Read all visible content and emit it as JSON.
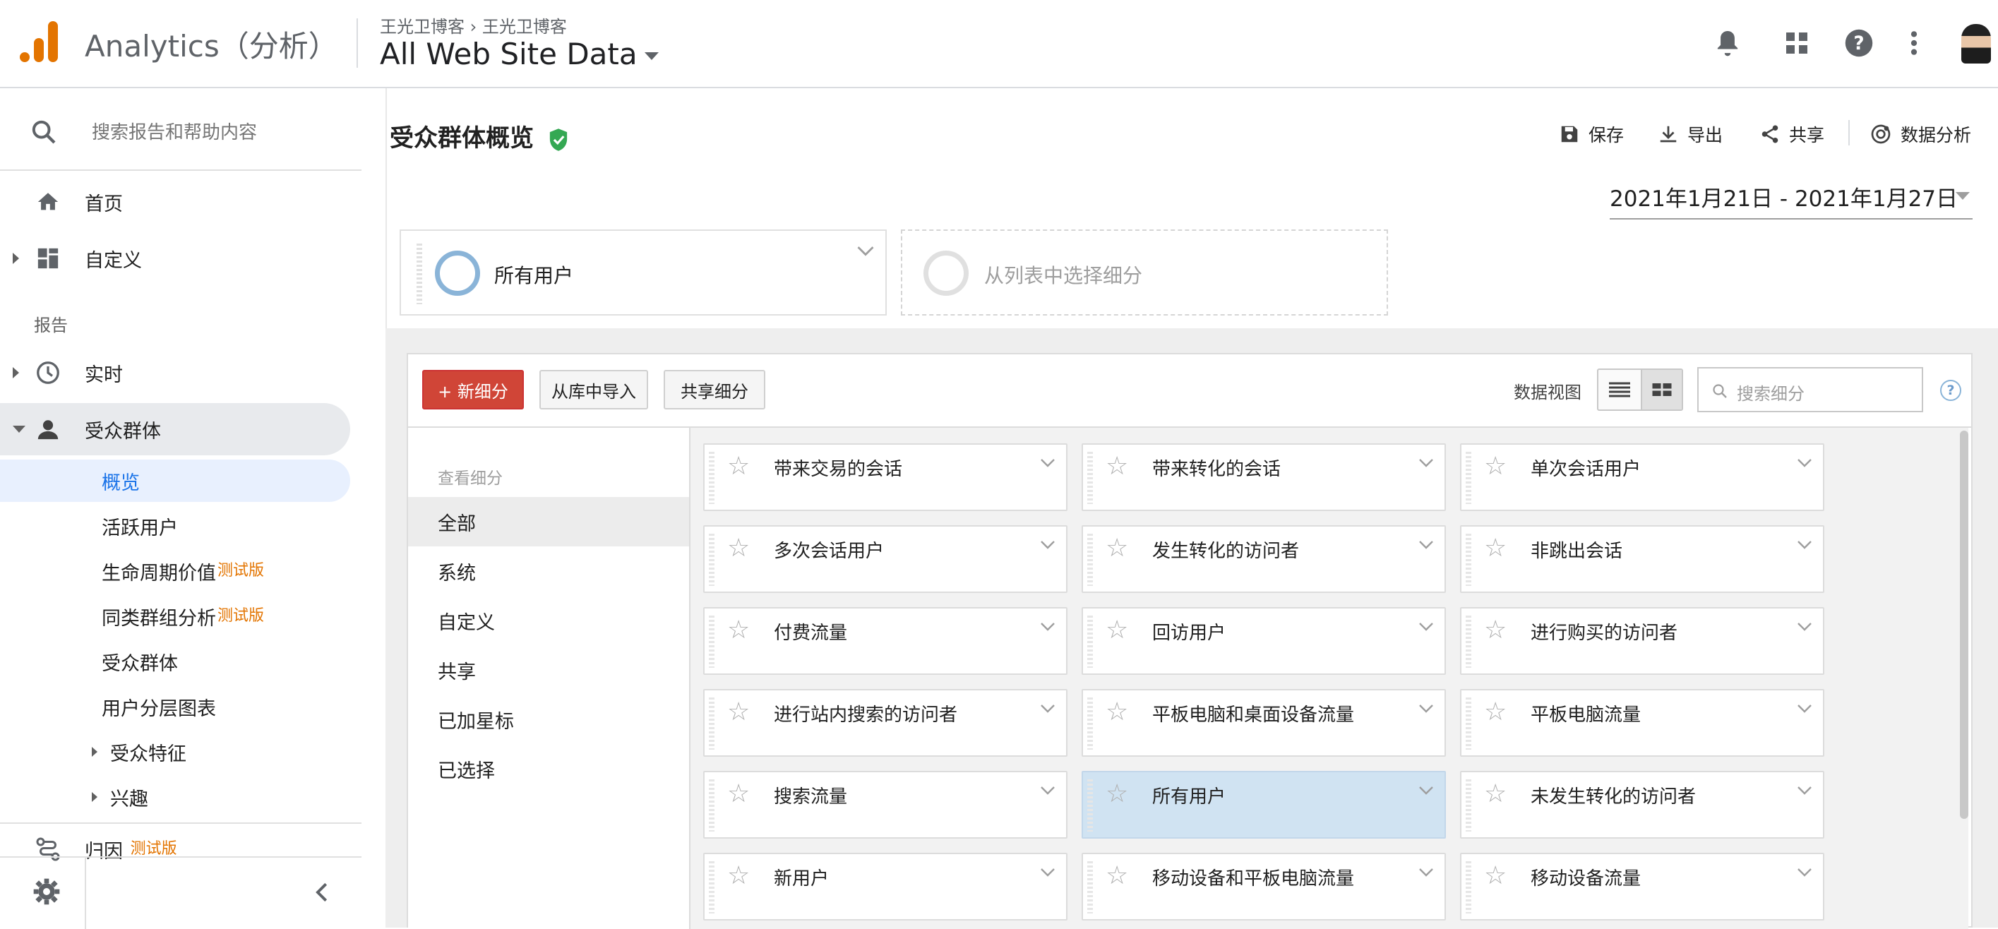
{
  "app": {
    "name": "Analytics（分析）",
    "breadcrumb_account": "王光卫博客",
    "breadcrumb_property": "王光卫博客",
    "view": "All Web Site Data"
  },
  "topbar_icons": [
    "bell-icon",
    "apps-icon",
    "help-icon",
    "more-vert-icon"
  ],
  "sidebar": {
    "search_placeholder": "搜索报告和帮助内容",
    "home": "首页",
    "customize": "自定义",
    "reports_section": "报告",
    "realtime": "实时",
    "audience": "受众群体",
    "audience_sub": [
      {
        "label": "概览"
      },
      {
        "label": "活跃用户"
      },
      {
        "label": "生命周期价值",
        "badge": "测试版"
      },
      {
        "label": "同类群组分析",
        "badge": "测试版"
      },
      {
        "label": "受众群体"
      },
      {
        "label": "用户分层图表"
      }
    ],
    "demographics": "受众特征",
    "interests": "兴趣",
    "attribution": "归因",
    "attribution_badge": "测试版"
  },
  "page": {
    "title": "受众群体概览",
    "actions": {
      "save": "保存",
      "export": "导出",
      "share": "共享",
      "insights": "数据分析"
    },
    "date_range": "2021年1月21日 - 2021年1月27日"
  },
  "segments": {
    "active": "所有用户",
    "placeholder": "从列表中选择细分"
  },
  "segment_picker": {
    "new_segment": "+ 新细分",
    "import_gallery": "从库中导入",
    "share_segments": "共享细分",
    "view_label": "数据视图",
    "search_placeholder": "搜索细分",
    "help": "?",
    "view_segments_label": "查看细分",
    "categories": [
      "全部",
      "系统",
      "自定义",
      "共享",
      "已加星标",
      "已选择"
    ],
    "selected_category": "全部",
    "tiles": [
      [
        "带来交易的会话",
        "带来转化的会话",
        "单次会话用户"
      ],
      [
        "多次会话用户",
        "发生转化的访问者",
        "非跳出会话"
      ],
      [
        "付费流量",
        "回访用户",
        "进行购买的访问者"
      ],
      [
        "进行站内搜索的访问者",
        "平板电脑和桌面设备流量",
        "平板电脑流量"
      ],
      [
        "搜索流量",
        "所有用户",
        "未发生转化的访问者"
      ],
      [
        "新用户",
        "移动设备和平板电脑流量",
        "移动设备流量"
      ]
    ],
    "highlighted_tile": "所有用户"
  }
}
